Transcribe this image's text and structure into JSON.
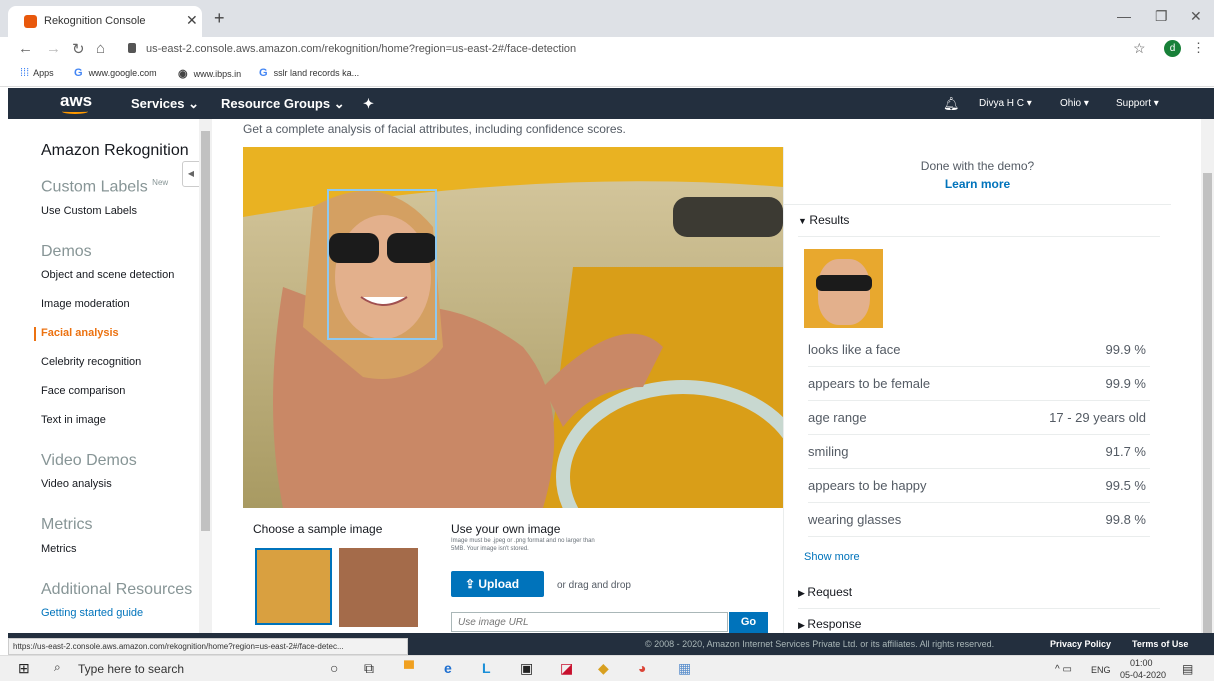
{
  "browser": {
    "tab_title": "Rekognition Console",
    "url": "us-east-2.console.aws.amazon.com/rekognition/home?region=us-east-2#/face-detection",
    "profile_initial": "d",
    "bookmarks": [
      "Apps",
      "www.google.com",
      "www.ibps.in",
      "sslr land records ka..."
    ]
  },
  "aws_nav": {
    "logo": "aws",
    "services": "Services ⌄",
    "resource_groups": "Resource Groups ⌄",
    "user": "Divya H C ▾",
    "region": "Ohio ▾",
    "support": "Support ▾"
  },
  "sidebar": {
    "title": "Amazon Rekognition",
    "custom_labels": "Custom Labels",
    "new_badge": "New",
    "use_custom_labels": "Use Custom Labels",
    "demos_heading": "Demos",
    "demos": [
      "Object and scene detection",
      "Image moderation",
      "Facial analysis",
      "Celebrity recognition",
      "Face comparison",
      "Text in image"
    ],
    "video_heading": "Video Demos",
    "video_item": "Video analysis",
    "metrics_heading": "Metrics",
    "metrics_item": "Metrics",
    "resources_heading": "Additional Resources",
    "resources_item": "Getting started guide"
  },
  "main": {
    "subtitle": "Get a complete analysis of facial attributes, including confidence scores.",
    "choose_sample": "Choose a sample image",
    "use_own": "Use your own image",
    "own_note": "Image must be .jpeg or .png format and no larger than 5MB. Your image isn't stored.",
    "upload": "Upload",
    "drag_drop": "or drag and drop",
    "url_placeholder": "Use image URL",
    "go": "Go"
  },
  "panel": {
    "done_demo": "Done with the demo?",
    "learn_more": "Learn more",
    "results_label": "Results",
    "results": [
      {
        "k": "looks like a face",
        "v": "99.9 %"
      },
      {
        "k": "appears to be female",
        "v": "99.9 %"
      },
      {
        "k": "age range",
        "v": "17 - 29 years old"
      },
      {
        "k": "smiling",
        "v": "91.7 %"
      },
      {
        "k": "appears to be happy",
        "v": "99.5 %"
      },
      {
        "k": "wearing glasses",
        "v": "99.8 %"
      }
    ],
    "show_more": "Show more",
    "request": "Request",
    "response": "Response"
  },
  "footer": {
    "status_url": "https://us-east-2.console.aws.amazon.com/rekognition/home?region=us-east-2#/face-detec...",
    "copyright": "© 2008 - 2020, Amazon Internet Services Private Ltd. or its affiliates. All rights reserved.",
    "privacy": "Privacy Policy",
    "terms": "Terms of Use"
  },
  "taskbar": {
    "search": "Type here to search",
    "lang": "ENG",
    "time": "01:00",
    "date": "05-04-2020"
  }
}
